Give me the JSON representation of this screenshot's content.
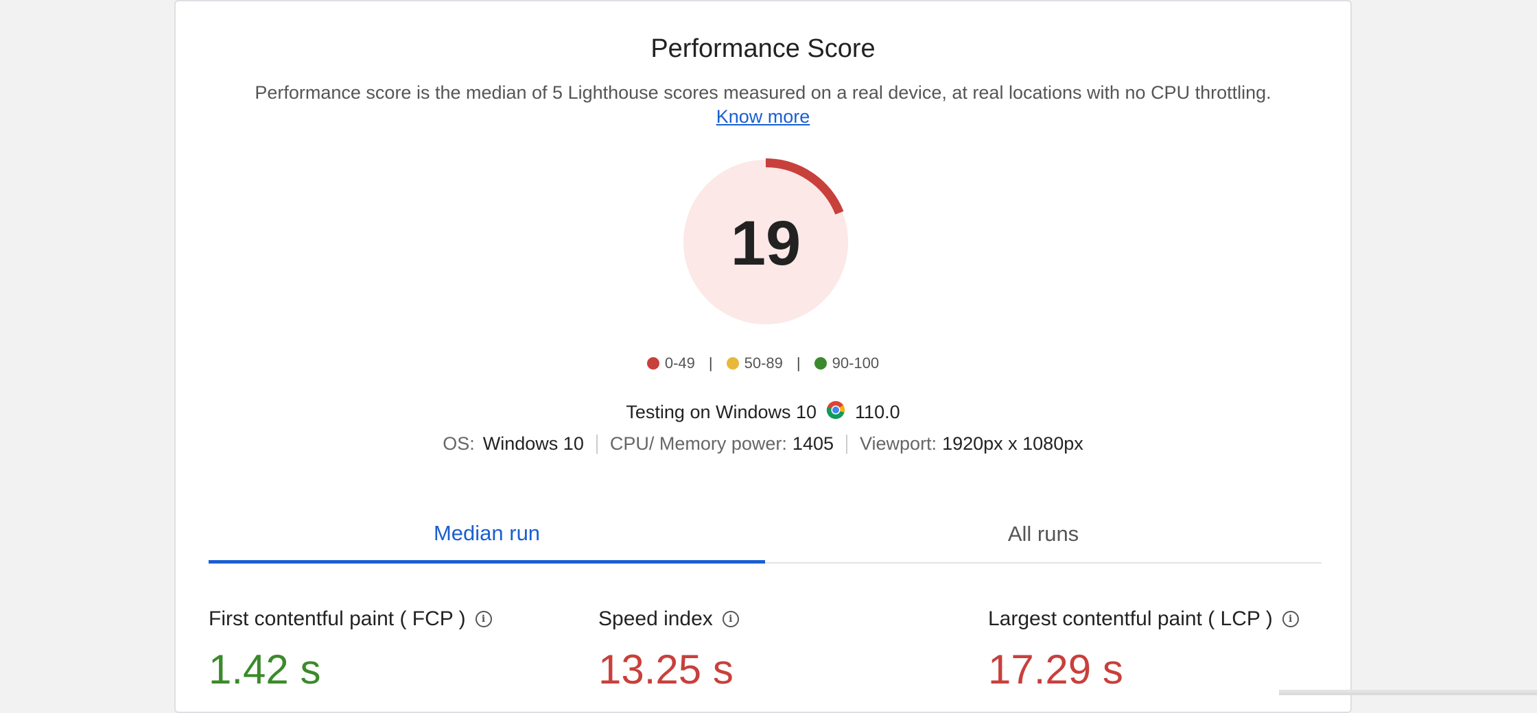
{
  "header": {
    "title": "Performance Score",
    "description": "Performance score is the median of 5 Lighthouse scores measured on a real device, at real locations with no CPU throttling.",
    "know_more": "Know more"
  },
  "score": {
    "value": "19",
    "fraction": 0.19,
    "color": "#c8403c",
    "bg_color": "#fbe8e7"
  },
  "legend": [
    {
      "label": "0-49",
      "color": "#c8403c"
    },
    {
      "label": "50-89",
      "color": "#e9b83a"
    },
    {
      "label": "90-100",
      "color": "#3b8a2b"
    }
  ],
  "testing": {
    "text": "Testing on Windows 10",
    "browser_icon": "chrome-icon",
    "browser_version": "110.0"
  },
  "specs": {
    "os_label": "OS:",
    "os_value": "Windows 10",
    "cpu_label": "CPU/ Memory power:",
    "cpu_value": "1405",
    "viewport_label": "Viewport:",
    "viewport_value": "1920px x 1080px"
  },
  "tabs": [
    {
      "label": "Median run",
      "active": true
    },
    {
      "label": "All runs",
      "active": false
    }
  ],
  "metrics": [
    {
      "label": "First contentful paint ( FCP )",
      "value": "1.42 s",
      "color": "#3b8a2b"
    },
    {
      "label": "Speed index",
      "value": "13.25 s",
      "color": "#c8403c"
    },
    {
      "label": "Largest contentful paint ( LCP )",
      "value": "17.29 s",
      "color": "#c8403c"
    }
  ]
}
